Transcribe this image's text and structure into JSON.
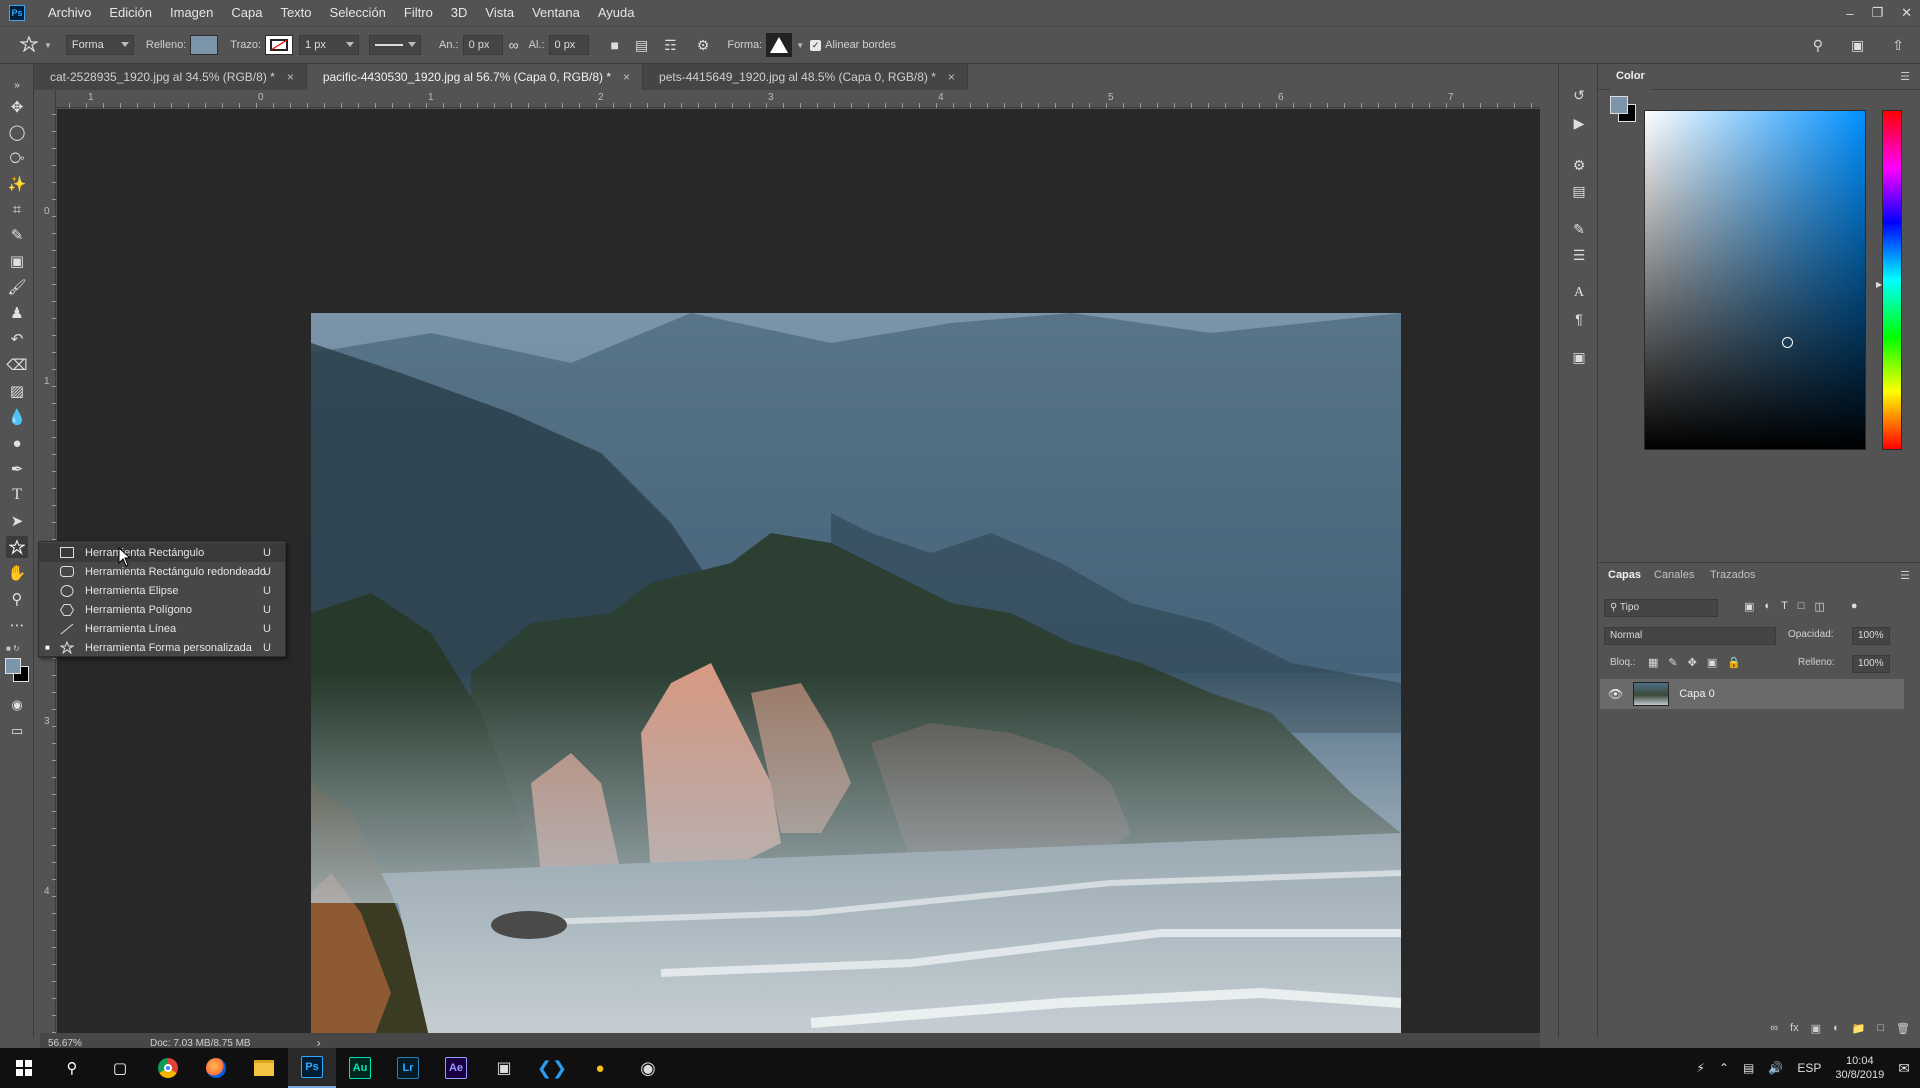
{
  "menu": {
    "logo": "Ps",
    "items": [
      "Archivo",
      "Edición",
      "Imagen",
      "Capa",
      "Texto",
      "Selección",
      "Filtro",
      "3D",
      "Vista",
      "Ventana",
      "Ayuda"
    ]
  },
  "options": {
    "mode": "Forma",
    "fill_label": "Relleno:",
    "fill_color": "#7d95aa",
    "stroke_label": "Trazo:",
    "stroke_width": "1 px",
    "width_label": "An.:",
    "width_value": "0 px",
    "height_label": "Al.:",
    "height_value": "0 px",
    "shape_label": "Forma:",
    "align_label": "Alinear bordes"
  },
  "tabs": [
    {
      "label": "cat-2528935_1920.jpg al 34.5% (RGB/8) *",
      "close": "×"
    },
    {
      "label": "pacific-4430530_1920.jpg al 56.7% (Capa 0, RGB/8) *",
      "close": "×"
    },
    {
      "label": "pets-4415649_1920.jpg al 48.5% (Capa 0, RGB/8) *",
      "close": "×"
    }
  ],
  "ruler": {
    "top": [
      "1",
      "0",
      "1",
      "2",
      "3",
      "4",
      "5",
      "6",
      "7"
    ],
    "left": [
      "0",
      "1",
      "2",
      "3",
      "4"
    ]
  },
  "flyout": [
    {
      "label": "Herramienta Rectángulo",
      "key": "U",
      "icon": "rectangle-icon"
    },
    {
      "label": "Herramienta Rectángulo redondeado",
      "key": "U",
      "icon": "rounded-rectangle-icon"
    },
    {
      "label": "Herramienta Elipse",
      "key": "U",
      "icon": "ellipse-icon"
    },
    {
      "label": "Herramienta Polígono",
      "key": "U",
      "icon": "polygon-icon"
    },
    {
      "label": "Herramienta Línea",
      "key": "U",
      "icon": "line-icon"
    },
    {
      "label": "Herramienta Forma personalizada",
      "key": "U",
      "icon": "custom-shape-icon"
    }
  ],
  "status": {
    "zoom": "56.67%",
    "doc": "Doc: 7.03 MB/8.75 MB",
    "arrow": "›"
  },
  "color_panel": {
    "title": "Color",
    "fg_color": "#7d95aa",
    "bg_color": "#000000"
  },
  "layers_panel": {
    "tabs": [
      "Capas",
      "Canales",
      "Trazados"
    ],
    "filter": "Tipo",
    "blend_mode": "Normal",
    "opacity_label": "Opacidad:",
    "opacity_value": "100%",
    "lock_label": "Bloq.:",
    "fill_label": "Relleno:",
    "fill_value": "100%",
    "layer_name": "Capa 0"
  },
  "taskbar": {
    "apps": [
      "Au",
      "Lr",
      "Ae"
    ],
    "lang": "ESP",
    "time": "10:04",
    "date": "30/8/2019"
  }
}
